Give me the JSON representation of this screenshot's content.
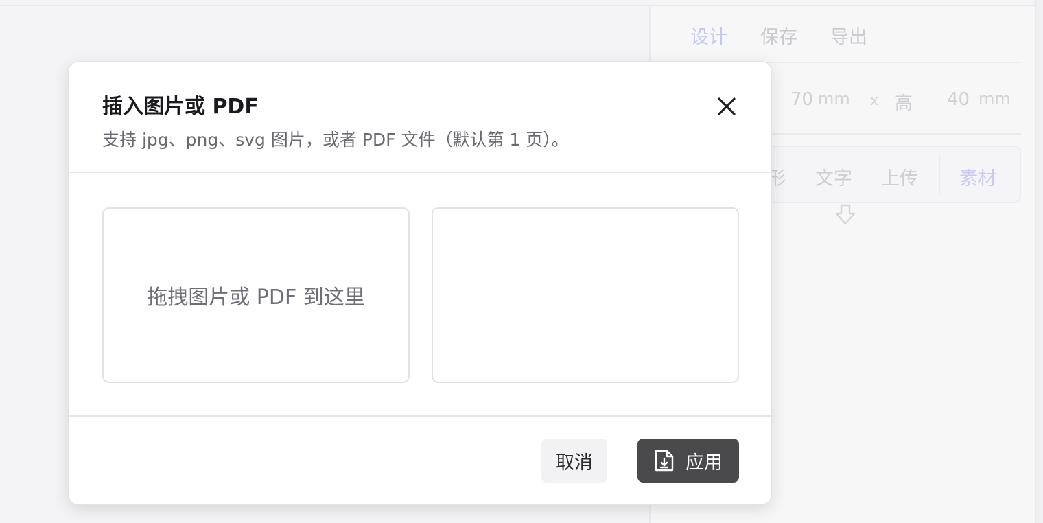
{
  "side_panel": {
    "tabs": [
      {
        "label": "设计",
        "active": true
      },
      {
        "label": "保存",
        "active": false
      },
      {
        "label": "导出",
        "active": false
      }
    ],
    "size": {
      "width_value": "70",
      "width_unit": "mm",
      "separator": "x",
      "height_label": "高",
      "height_value": "40",
      "height_unit": "mm"
    },
    "tools": [
      {
        "label": "形",
        "active": false
      },
      {
        "label": "文字",
        "active": false
      },
      {
        "label": "上传",
        "active": false
      },
      {
        "label": "素材",
        "active": true
      }
    ]
  },
  "modal": {
    "title": "插入图片或 PDF",
    "subtitle": "支持 jpg、png、svg 图片，或者 PDF 文件（默认第 1 页）。",
    "drop_zone_text": "拖拽图片或 PDF 到这里",
    "cancel_label": "取消",
    "apply_label": "应用"
  },
  "colors": {
    "primary_button": "#4a4a4d",
    "active_tab": "#c4c8f2"
  }
}
